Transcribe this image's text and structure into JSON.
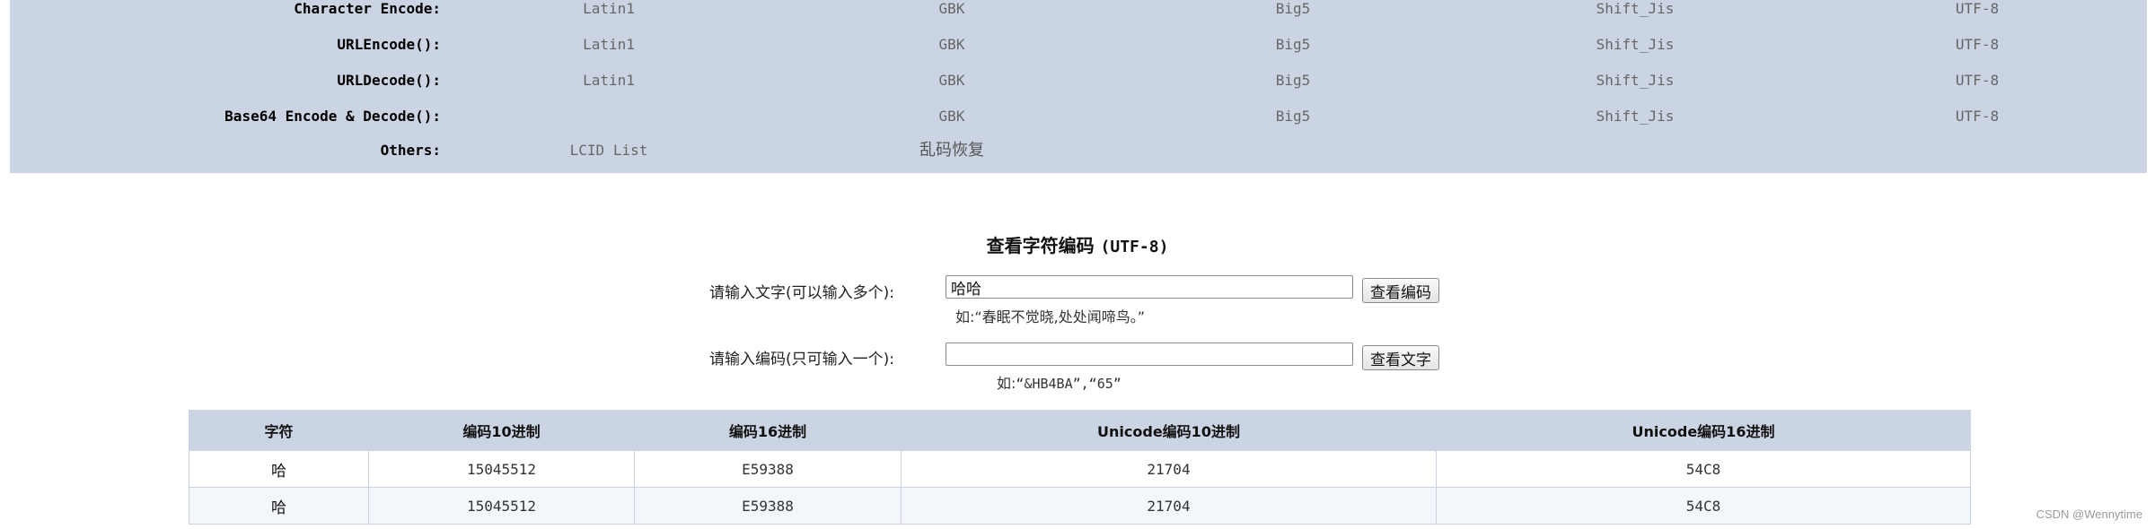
{
  "nav": {
    "rows": [
      {
        "label": "Character Encode:",
        "links": [
          "Latin1",
          "GBK",
          "Big5",
          "Shift_Jis",
          "UTF-8"
        ]
      },
      {
        "label": "URLEncode():",
        "links": [
          "Latin1",
          "GBK",
          "Big5",
          "Shift_Jis",
          "UTF-8"
        ]
      },
      {
        "label": "URLDecode():",
        "links": [
          "Latin1",
          "GBK",
          "Big5",
          "Shift_Jis",
          "UTF-8"
        ]
      },
      {
        "label": "Base64 Encode & Decode():",
        "links": [
          "GBK",
          "Big5",
          "Shift_Jis",
          "UTF-8"
        ]
      },
      {
        "label": "Others:",
        "links": [
          "LCID List",
          "乱码恢复"
        ]
      }
    ]
  },
  "tool": {
    "title": "查看字符编码",
    "title_charset": "(UTF-8)",
    "text_label": "请输入文字(可以输入多个):",
    "text_value": "哈哈",
    "text_button": "查看编码",
    "text_hint": "如:“春眠不觉晓,处处闻啼鸟。”",
    "code_label": "请输入编码(只可输入一个):",
    "code_value": "",
    "code_button": "查看文字",
    "code_hint_prefix": "如:",
    "code_hint": "“&HB4BA”,“65”"
  },
  "table": {
    "headers": [
      "字符",
      "编码10进制",
      "编码16进制",
      "Unicode编码10进制",
      "Unicode编码16进制"
    ],
    "rows": [
      [
        "哈",
        "15045512",
        "E59388",
        "21704",
        "54C8"
      ],
      [
        "哈",
        "15045512",
        "E59388",
        "21704",
        "54C8"
      ]
    ]
  },
  "watermark": "CSDN @Wennytime"
}
